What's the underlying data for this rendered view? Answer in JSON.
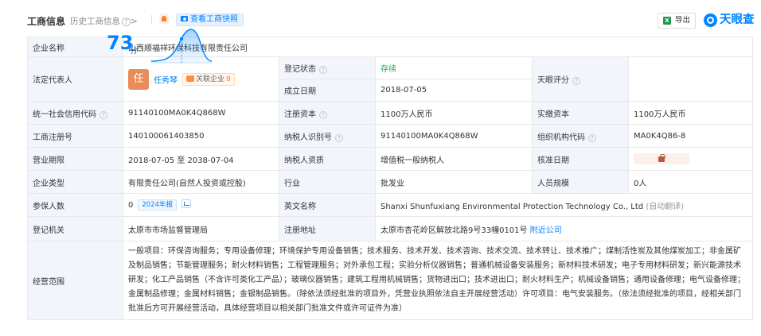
{
  "header": {
    "title": "工商信息",
    "history_label": "历史工商信息",
    "history_arrow": ">",
    "snapshot_button": "查看工商快照",
    "export_button": "导出",
    "logo_text": "天眼查"
  },
  "info": {
    "company_name": {
      "label": "企业名称",
      "value": "山西顺福祥环保科技有限责任公司"
    },
    "legal_rep": {
      "label": "法定代表人",
      "avatar_char": "任",
      "name": "任秀琴",
      "related_label": "关联企业",
      "related_count": "8"
    },
    "reg_status": {
      "label": "登记状态",
      "value": "存续"
    },
    "est_date": {
      "label": "成立日期",
      "value": "2018-07-05"
    },
    "score": {
      "label": "天眼评分",
      "value": "73",
      "unit": "分"
    },
    "credit_code": {
      "label": "统一社会信用代码",
      "value": "91140100MA0K4Q868W"
    },
    "reg_capital": {
      "label": "注册资本",
      "value": "1100万人民币"
    },
    "paid_capital": {
      "label": "实缴资本",
      "value": "1100万人民币"
    },
    "reg_number": {
      "label": "工商注册号",
      "value": "140100061403850"
    },
    "taxpayer_id": {
      "label": "纳税人识别号",
      "value": "91140100MA0K4Q868W"
    },
    "org_code": {
      "label": "组织机构代码",
      "value": "MA0K4Q86-8"
    },
    "term": {
      "label": "营业期限",
      "value": "2018-07-05 至 2038-07-04"
    },
    "taxpayer_qual": {
      "label": "纳税人资质",
      "value": "增值税一般纳税人"
    },
    "approval_date": {
      "label": "核准日期"
    },
    "company_type": {
      "label": "企业类型",
      "value": "有限责任公司(自然人投资或控股)"
    },
    "industry": {
      "label": "行业",
      "value": "批发业"
    },
    "staff_size": {
      "label": "人员规模",
      "value": "0人"
    },
    "insured": {
      "label": "参保人数",
      "value": "0",
      "report_tag": "2024年报"
    },
    "english_name": {
      "label": "英文名称",
      "value": "Shanxi Shunfuxiang Environmental Protection Technology Co., Ltd",
      "note": "(自动翻译)"
    },
    "reg_authority": {
      "label": "登记机关",
      "value": "太原市市场监督管理局"
    },
    "reg_address": {
      "label": "注册地址",
      "value": "太原市杏花岭区解放北路9号33幢0101号",
      "nearby_link": "附近公司"
    },
    "scope": {
      "label": "经营范围",
      "value": "一般项目：环保咨询服务；专用设备修理；环境保护专用设备销售；技术服务、技术开发、技术咨询、技术交流、技术转让、技术推广；煤制活性炭及其他煤炭加工；非金属矿及制品销售；节能管理服务；耐火材料销售；工程管理服务；对外承包工程；实验分析仪器销售；普通机械设备安装服务；新材料技术研发；电子专用材料研发；新兴能源技术研发；化工产品销售（不含许可类化工产品）；玻璃仪器销售；建筑工程用机械销售；货物进出口；技术进出口；耐火材料生产；机械设备销售；通用设备修理；电气设备修理；金属制品修理；金属材料销售；金银制品销售。（除依法须经批准的项目外，凭营业执照依法自主开展经营活动）许可项目：电气安装服务。（依法须经批准的项目，经相关部门批准后方可开展经营活动，具体经营项目以相关部门批准文件或许可证件为准）"
    }
  },
  "colors": {
    "accent": "#0084ff",
    "status": "#1fad4b",
    "label_bg": "#f2f6fc",
    "avatar": "#e88c5c"
  }
}
